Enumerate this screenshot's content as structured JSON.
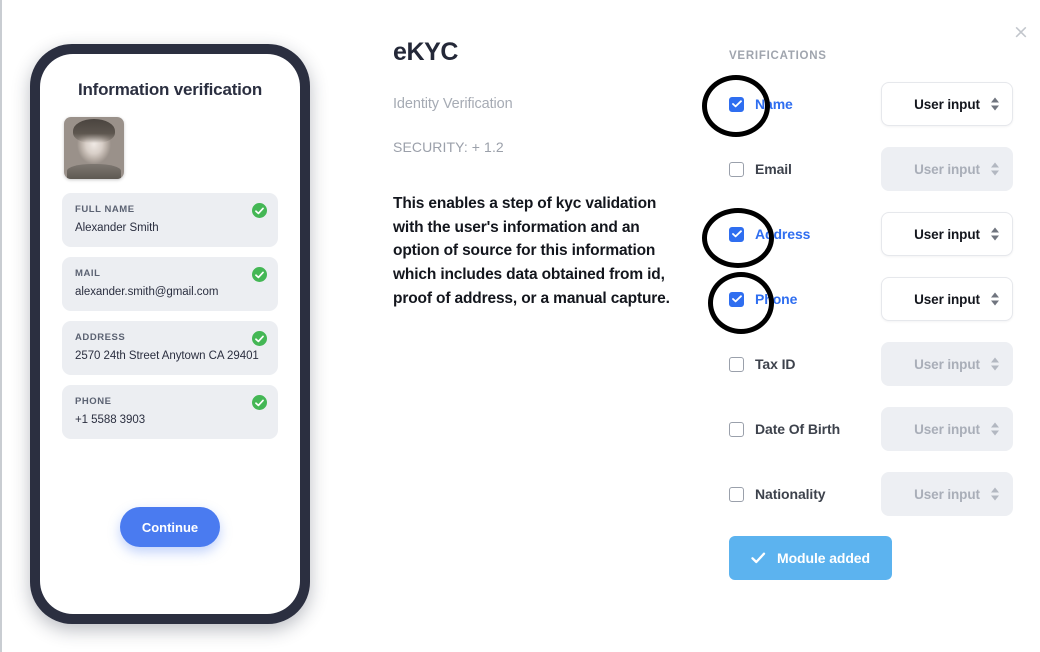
{
  "dialog": {
    "close_icon": "close-icon",
    "close_glyph": "×"
  },
  "phone": {
    "title": "Information verification",
    "avatar_alt": "user-portrait",
    "fields": [
      {
        "label": "FULL NAME",
        "value": "Alexander Smith",
        "verified": true
      },
      {
        "label": "MAIL",
        "value": "alexander.smith@gmail.com",
        "verified": true
      },
      {
        "label": "ADDRESS",
        "value": "2570 24th Street Anytown CA 29401",
        "verified": true
      },
      {
        "label": "PHONE",
        "value": "+1 5588 3903",
        "verified": true
      }
    ],
    "continue_label": "Continue",
    "continue_color": "#4a7bf0",
    "verified_badge_color": "#44b755"
  },
  "details": {
    "title": "eKYC",
    "subtitle": "Identity Verification",
    "security": "SECURITY: + 1.2",
    "description": "This enables a step of kyc validation with the user's information and an option of source for this information which includes data obtained from id, proof of address, or a manual capture."
  },
  "verifications": {
    "heading": "VERIFICATIONS",
    "accent_color": "#2f6ef0",
    "rows": [
      {
        "label": "Name",
        "checked": true,
        "source": "User input",
        "annotated": true
      },
      {
        "label": "Email",
        "checked": false,
        "source": "User input",
        "annotated": false
      },
      {
        "label": "Address",
        "checked": true,
        "source": "User input",
        "annotated": true
      },
      {
        "label": "Phone",
        "checked": true,
        "source": "User input",
        "annotated": true
      },
      {
        "label": "Tax ID",
        "checked": false,
        "source": "User input",
        "annotated": false
      },
      {
        "label": "Date Of Birth",
        "checked": false,
        "source": "User input",
        "annotated": false
      },
      {
        "label": "Nationality",
        "checked": false,
        "source": "User input",
        "annotated": false
      }
    ],
    "module_button": {
      "label": "Module added",
      "icon": "check-icon",
      "color": "#5cb3ef"
    }
  }
}
